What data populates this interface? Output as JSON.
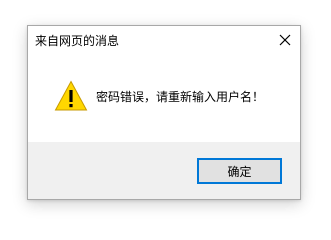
{
  "dialog": {
    "title": "来自网页的消息",
    "message": "密码错误，请重新输入用户名！",
    "ok_label": "确定"
  },
  "icons": {
    "close": "close-icon",
    "warning": "warning-icon"
  },
  "colors": {
    "accent": "#0078d7",
    "warning_fill": "#ffd700",
    "footer_bg": "#f0f0f0"
  }
}
